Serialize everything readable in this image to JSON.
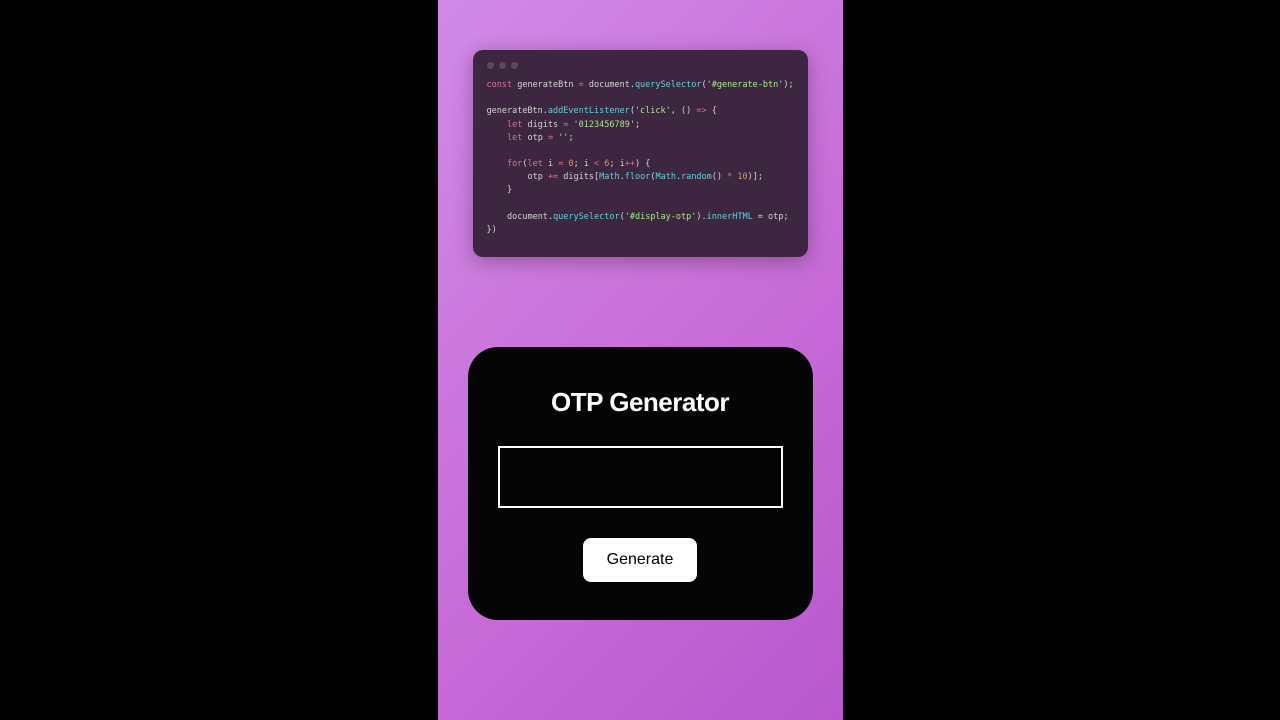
{
  "code": {
    "line1_kw": "const",
    "line1_var": " generateBtn ",
    "line1_op": "=",
    "line1_obj": " document",
    "line1_dot": ".",
    "line1_func": "querySelector",
    "line1_open": "(",
    "line1_str": "'#generate-btn'",
    "line1_close": ");",
    "line3_obj": "generateBtn",
    "line3_dot": ".",
    "line3_func": "addEventListener",
    "line3_open": "(",
    "line3_str": "'click'",
    "line3_comma": ", () ",
    "line3_arrow": "=>",
    "line3_brace": " {",
    "line4_indent": "    ",
    "line4_kw": "let",
    "line4_var": " digits ",
    "line4_op": "=",
    "line4_sp": " ",
    "line4_str": "'0123456789'",
    "line4_semi": ";",
    "line5_indent": "    ",
    "line5_kw": "let",
    "line5_var": " otp ",
    "line5_op": "=",
    "line5_sp": " ",
    "line5_str": "''",
    "line5_semi": ";",
    "line7_indent": "    ",
    "line7_for": "for",
    "line7_open": "(",
    "line7_let": "let",
    "line7_i": " i ",
    "line7_eq": "=",
    "line7_sp1": " ",
    "line7_zero": "0",
    "line7_semi1": "; i ",
    "line7_lt": "<",
    "line7_sp2": " ",
    "line7_six": "6",
    "line7_semi2": "; i",
    "line7_inc": "++",
    "line7_close": ") {",
    "line8_indent": "        ",
    "line8_otp": "otp ",
    "line8_pluseq": "+=",
    "line8_digits": " digits[",
    "line8_math": "Math",
    "line8_dot1": ".",
    "line8_floor": "floor",
    "line8_open1": "(",
    "line8_math2": "Math",
    "line8_dot2": ".",
    "line8_random": "random",
    "line8_parens": "() ",
    "line8_mult": "*",
    "line8_sp": " ",
    "line8_ten": "10",
    "line8_close": ")];",
    "line9_indent": "    ",
    "line9_brace": "}",
    "line11_indent": "    ",
    "line11_doc": "document",
    "line11_dot": ".",
    "line11_qs": "querySelector",
    "line11_open": "(",
    "line11_str": "'#display-otp'",
    "line11_close": ").",
    "line11_inner": "innerHTML",
    "line11_eq": " = ",
    "line11_otp": "otp;",
    "line12": "})"
  },
  "otp": {
    "title": "OTP Generator",
    "display_value": "",
    "button_label": "Generate"
  }
}
